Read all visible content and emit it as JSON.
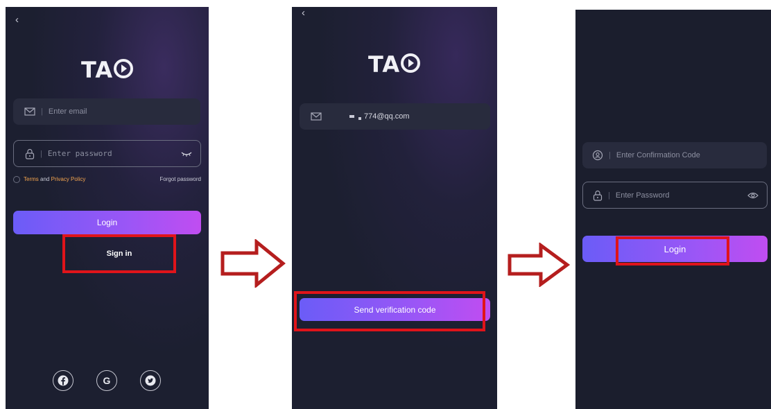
{
  "brand": {
    "logo_text": "TA"
  },
  "screen1": {
    "back_icon": "chevron-left-icon",
    "email_placeholder": "Enter email",
    "password_placeholder": "Enter password",
    "terms_label": "Terms",
    "and_label": "and",
    "privacy_label": "Privacy Policy",
    "forgot_label": "Forgot password",
    "login_label": "Login",
    "signin_label": "Sign in",
    "social_icons": [
      "facebook-icon",
      "google-icon",
      "twitter-icon"
    ],
    "google_letter": "G"
  },
  "screen2": {
    "back_icon": "chevron-left-icon",
    "email_value": "774@qq.com",
    "send_code_label": "Send verification code"
  },
  "screen3": {
    "code_placeholder": "Enter Confirmation Code",
    "password_placeholder": "Enter Password",
    "login_label": "Login"
  },
  "colors": {
    "background": "#1c1f30",
    "field": "#282b3d",
    "button_gradient_start": "#6b5cf7",
    "button_gradient_end": "#c04df1",
    "highlight": "#e0141a",
    "arrow": "#b51e1e",
    "accent": "#f3a44e"
  }
}
